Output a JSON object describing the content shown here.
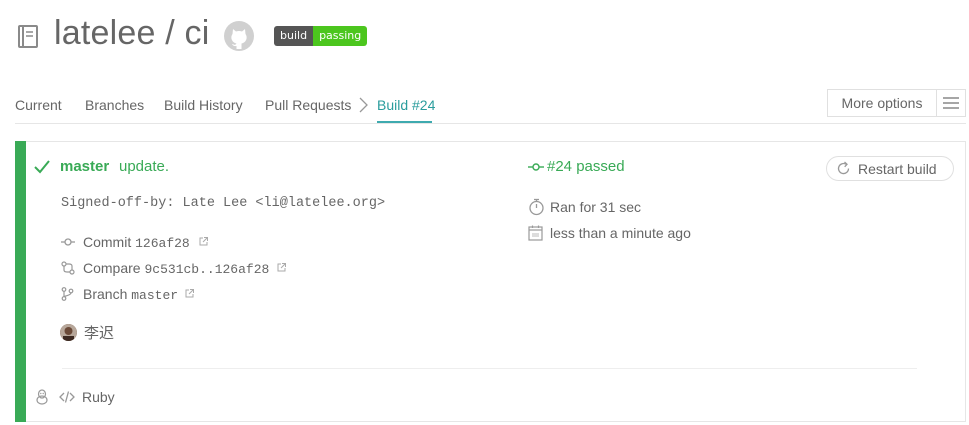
{
  "header": {
    "repo_title": "latelee / ci",
    "badge_left": "build",
    "badge_right": "passing"
  },
  "nav": {
    "current": "Current",
    "branches": "Branches",
    "build_history": "Build History",
    "pull_requests": "Pull Requests",
    "build": "Build #24",
    "more_options": "More options"
  },
  "build": {
    "branch": "master",
    "message": "update.",
    "signoff": "Signed-off-by: Late Lee <li@latelee.org>",
    "commit_label": "Commit",
    "commit_sha": "126af28",
    "compare_label": "Compare",
    "compare_range": "9c531cb..126af28",
    "branch_label": "Branch",
    "branch_name": "master",
    "author": "李迟",
    "language": "Ruby",
    "number_status": "#24 passed",
    "ran_for": "Ran for 31 sec",
    "finished": "less than a minute ago",
    "restart": "Restart build"
  },
  "colors": {
    "passed": "#39aa56",
    "accent": "#3eaaaf",
    "badge_pass": "#4cc61e"
  },
  "icons": [
    "repo-icon",
    "github-icon",
    "check-icon",
    "commit-icon",
    "compare-icon",
    "branch-icon",
    "linux-icon",
    "code-icon",
    "timer-icon",
    "calendar-icon",
    "restart-icon",
    "hamburger-icon",
    "external-link-icon"
  ]
}
